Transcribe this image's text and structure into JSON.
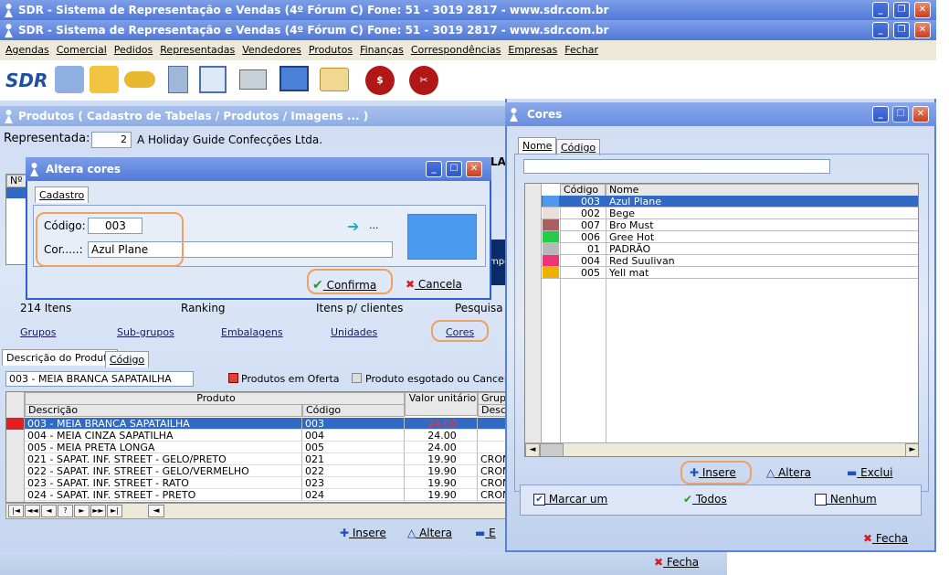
{
  "app": {
    "title": "SDR - Sistema de Representação e Vendas  (4º Fórum C)  Fone: 51 - 3019 2817 - www.sdr.com.br",
    "logo": "SDR",
    "menu": [
      "Agendas",
      "Comercial",
      "Pedidos",
      "Representadas",
      "Vendedores",
      "Produtos",
      "Finanças",
      "Correspondências",
      "Empresas",
      "Fechar"
    ]
  },
  "produtos": {
    "title": "Produtos ( Cadastro de Tabelas / Produtos / Imagens ... )",
    "representada_label": "Representada:",
    "representada_code": "2",
    "representada_name": "A Holiday Guide Confecções Ltda.",
    "col_n": "Nº",
    "stats": [
      "214 Itens",
      "Ranking",
      "Itens p/ clientes",
      "Pesquisa"
    ],
    "links": [
      "Grupos",
      "Sub-grupos",
      "Embalagens",
      "Unidades",
      "Cores"
    ],
    "tabs": [
      "Descrição do Produto",
      "Código"
    ],
    "search_value": "003 - MEIA BRANCA SAPATAILHA",
    "legend_offer": "Produtos em Oferta",
    "legend_out": "Produto esgotado ou Cancelado",
    "grid_group_produto": "Produto",
    "grid_headers": [
      "Descrição",
      "Código",
      "Valor unitário",
      "Grupo"
    ],
    "grid_sub_grupo": "Descri",
    "rows": [
      {
        "desc": "003 - MEIA BRANCA SAPATAILHA",
        "code": "003",
        "value": "24.00",
        "group": ""
      },
      {
        "desc": "004 - MEIA CINZA SAPATILHA",
        "code": "004",
        "value": "24.00",
        "group": ""
      },
      {
        "desc": "005 - MEIA PRETA LONGA",
        "code": "005",
        "value": "24.00",
        "group": ""
      },
      {
        "desc": "021 - SAPAT. INF. STREET - GELO/PRETO",
        "code": "021",
        "value": "19.90",
        "group": "CROM"
      },
      {
        "desc": "022 - SAPAT. INF. STREET - GELO/VERMELHO",
        "code": "022",
        "value": "19.90",
        "group": "CROM"
      },
      {
        "desc": "023 - SAPAT. INF. STREET - RATO",
        "code": "023",
        "value": "19.90",
        "group": "CROM"
      },
      {
        "desc": "024 - SAPAT. INF. STREET - PRETO",
        "code": "024",
        "value": "19.90",
        "group": "CROM"
      }
    ],
    "nav": [
      "|◄",
      "◄◄",
      "◄",
      "?",
      "►",
      "►►",
      "►|"
    ],
    "btn_insere": "Insere",
    "btn_altera": "Altera",
    "btn_exclui": "E",
    "btn_fecha": "Fecha",
    "hidden_text_1": "LA",
    "hidden_text_2": "mpo"
  },
  "altera": {
    "title": "Altera cores",
    "tab": "Cadastro",
    "codigo_label": "Código:",
    "codigo_value": "003",
    "cor_label": "Cor.....:",
    "cor_value": "Azul Plane",
    "arrow_text": "...",
    "swatch_color": "#4a9bf0",
    "confirma": "Confirma",
    "cancela": "Cancela"
  },
  "cores": {
    "title": "Cores",
    "tabs": [
      "Nome",
      "Código"
    ],
    "search_value": "",
    "headers": [
      "Código",
      "Nome"
    ],
    "rows": [
      {
        "color": "#4a9bf0",
        "code": "003",
        "name": "Azul Plane"
      },
      {
        "color": "#e8dede",
        "code": "002",
        "name": "Bege"
      },
      {
        "color": "#a86060",
        "code": "007",
        "name": "Bro Must"
      },
      {
        "color": "#22cc44",
        "code": "006",
        "name": "Gree Hot"
      },
      {
        "color": "#b8b8b8",
        "code": "01",
        "name": "PADRÃO"
      },
      {
        "color": "#ee3377",
        "code": "004",
        "name": "Red Suulivan"
      },
      {
        "color": "#f0b000",
        "code": "005",
        "name": "Yell mat"
      }
    ],
    "insere": "Insere",
    "altera": "Altera",
    "exclui": "Exclui",
    "marcar_um": "Marcar um",
    "todos": "Todos",
    "nenhum": "Nenhum",
    "fecha": "Fecha"
  }
}
